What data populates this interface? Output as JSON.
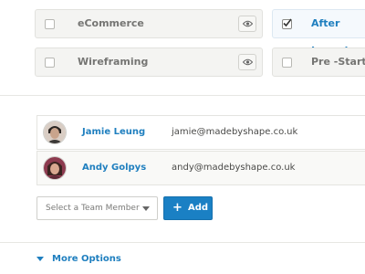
{
  "tasks": [
    {
      "label": "eCommerce",
      "checked": false
    },
    {
      "label": "After Launch",
      "checked": true
    },
    {
      "label": "Wireframing",
      "checked": false
    },
    {
      "label": "Pre -Start",
      "checked": false
    }
  ],
  "team_members": [
    {
      "name": "Jamie Leung",
      "email": "jamie@madebyshape.co.uk"
    },
    {
      "name": "Andy Golpys",
      "email": "andy@madebyshape.co.uk"
    }
  ],
  "team_select": {
    "selected": "Select a Team Member"
  },
  "add_button": {
    "label": "Add"
  },
  "more_options": {
    "label": "More Options"
  },
  "colors": {
    "accent": "#1f7fbf",
    "button": "#1a80c4"
  },
  "icons": [
    "eye-icon",
    "checkmark-icon",
    "chevron-down-icon",
    "plus-icon",
    "triangle-down-icon"
  ]
}
